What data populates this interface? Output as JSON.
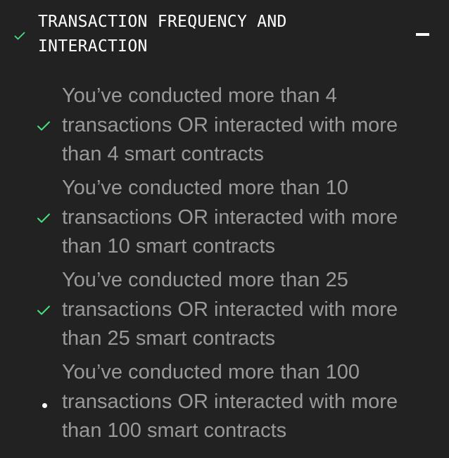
{
  "section": {
    "title": "TRANSACTION FREQUENCY AND INTERACTION",
    "status_icon": "check-icon",
    "collapse_icon": "minus-icon"
  },
  "items": [
    {
      "status": "complete",
      "icon": "check-icon",
      "text": "You’ve conducted more than 4 transactions OR interacted with more than 4 smart contracts"
    },
    {
      "status": "complete",
      "icon": "check-icon",
      "text": "You’ve conducted more than 10 transactions OR interacted with more than 10 smart contracts"
    },
    {
      "status": "complete",
      "icon": "check-icon",
      "text": "You’ve conducted more than 25 transactions OR interacted with more than 25 smart contracts"
    },
    {
      "status": "incomplete",
      "icon": "bullet-dot-icon",
      "text": "You’ve conducted more than 100 transactions OR interacted with more than 100 smart contracts"
    }
  ],
  "colors": {
    "background": "#222222",
    "check": "#4ade80",
    "title": "#ffffff",
    "item_text": "#9a9a9a"
  }
}
